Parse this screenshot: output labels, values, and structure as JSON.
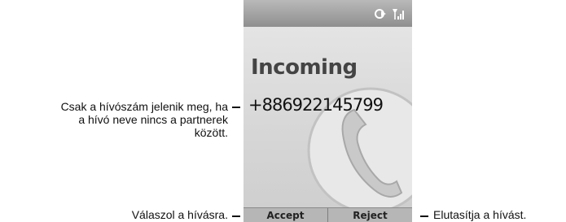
{
  "screen": {
    "title": "Incoming",
    "caller_number": "+886922145799",
    "status_icons": [
      "signal-forward-icon",
      "signal-strength-icon"
    ]
  },
  "softkeys": {
    "accept_label": "Accept",
    "reject_label": "Reject"
  },
  "annotations": {
    "caller_line1": "Csak a hívószám jelenik meg, ha",
    "caller_line2": "a hívó neve nincs a partnerek",
    "caller_line3": "között.",
    "accept": "Válaszol a hívásra.",
    "reject": "Elutasítja a hívást."
  },
  "colors": {
    "screen_background": "#d8d8d8",
    "status_bar": "#9a9a9a",
    "softkey_bar": "#b6b6b6",
    "title_text": "#444444"
  }
}
